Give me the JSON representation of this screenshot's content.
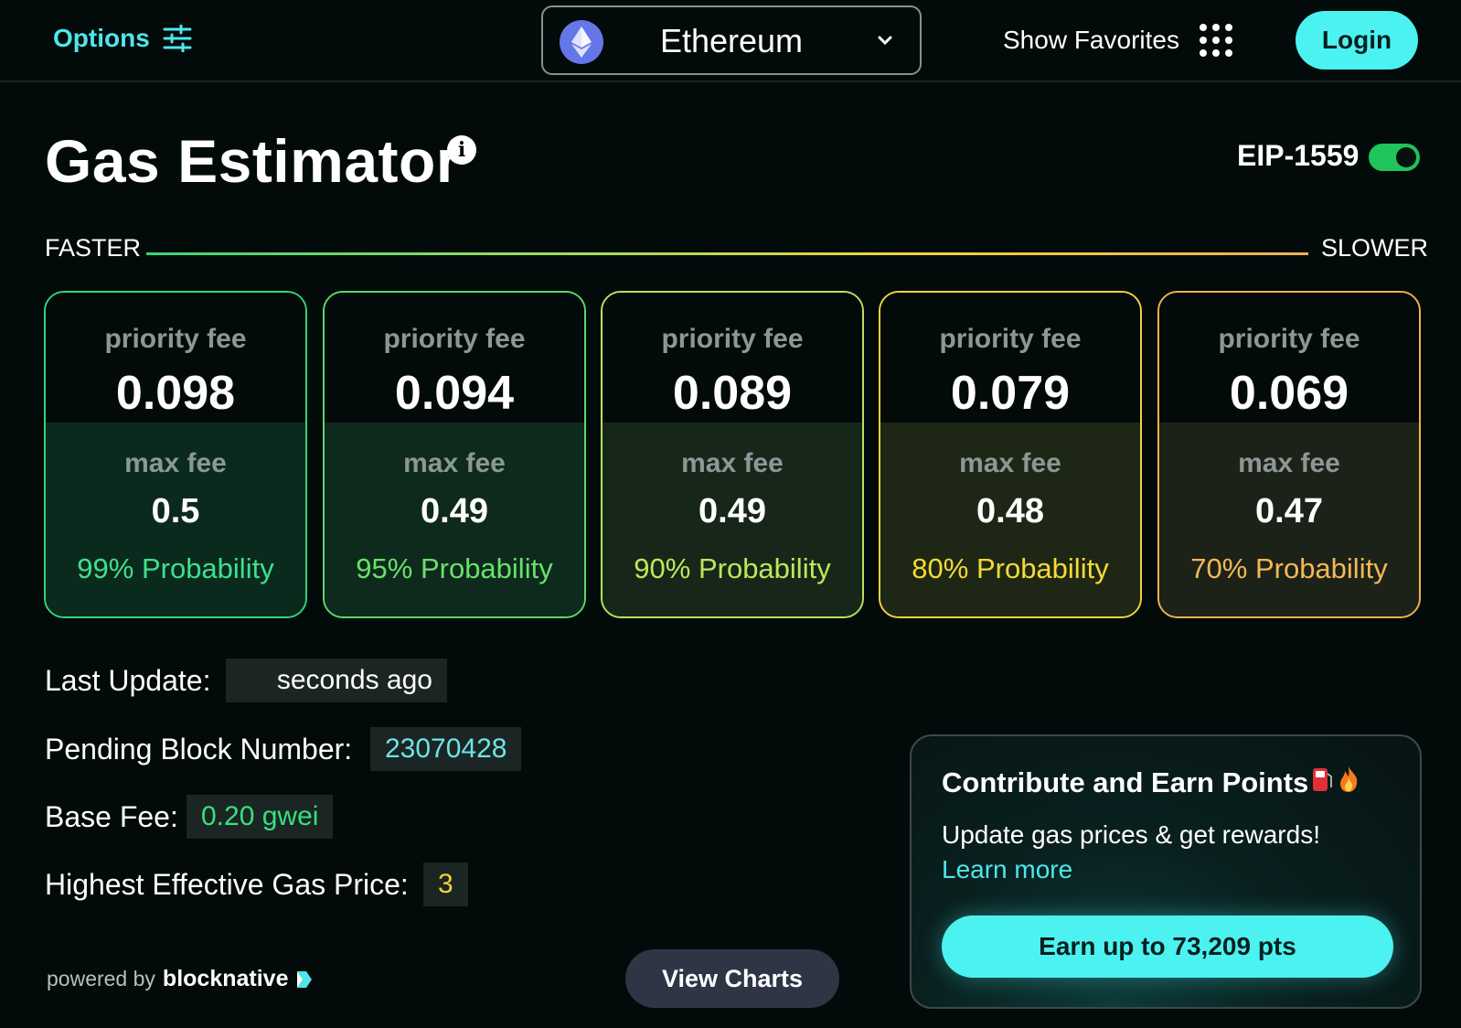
{
  "header": {
    "options_label": "Options",
    "network": "Ethereum",
    "favorites_label": "Show Favorites",
    "login_label": "Login"
  },
  "title": "Gas Estimator",
  "eip": {
    "label": "EIP-1559",
    "enabled": true
  },
  "speed": {
    "faster": "FASTER",
    "slower": "SLOWER"
  },
  "cards": [
    {
      "priority_label": "priority fee",
      "priority_fee": "0.098",
      "max_label": "max fee",
      "max_fee": "0.5",
      "probability": "99% Probability",
      "color": "#32d37c"
    },
    {
      "priority_label": "priority fee",
      "priority_fee": "0.094",
      "max_label": "max fee",
      "max_fee": "0.49",
      "probability": "95% Probability",
      "color": "#5cd86b"
    },
    {
      "priority_label": "priority fee",
      "priority_fee": "0.089",
      "max_label": "max fee",
      "max_fee": "0.49",
      "probability": "90% Probability",
      "color": "#b7e35a"
    },
    {
      "priority_label": "priority fee",
      "priority_fee": "0.079",
      "max_label": "max fee",
      "max_fee": "0.48",
      "probability": "80% Probability",
      "color": "#f2d33b"
    },
    {
      "priority_label": "priority fee",
      "priority_fee": "0.069",
      "max_label": "max fee",
      "max_fee": "0.47",
      "probability": "70% Probability",
      "color": "#f1b24d"
    }
  ],
  "stats": {
    "last_update_label": "Last Update:",
    "last_update_value": "seconds ago",
    "pending_block_label": "Pending Block Number:",
    "pending_block_value": "23070428",
    "base_fee_label": "Base Fee:",
    "base_fee_value": "0.20 gwei",
    "highest_label": "Highest Effective Gas Price:",
    "highest_value": "3"
  },
  "footer": {
    "powered_by": "powered by",
    "brand": "blocknative",
    "view_charts": "View Charts"
  },
  "promo": {
    "title": "Contribute and Earn Points",
    "subtitle": "Update gas prices & get rewards!",
    "learn_more": "Learn more",
    "cta": "Earn up to 73,209 pts"
  },
  "colors": {
    "accent": "#4cf2f0",
    "background": "#020b0a",
    "toggle_on": "#1fc45a"
  },
  "icons": [
    "sliders-icon",
    "ethereum-icon",
    "chevron-down-icon",
    "grid-dots-icon",
    "info-icon",
    "gas-pump-icon",
    "fire-icon",
    "blocknative-logo-icon"
  ]
}
